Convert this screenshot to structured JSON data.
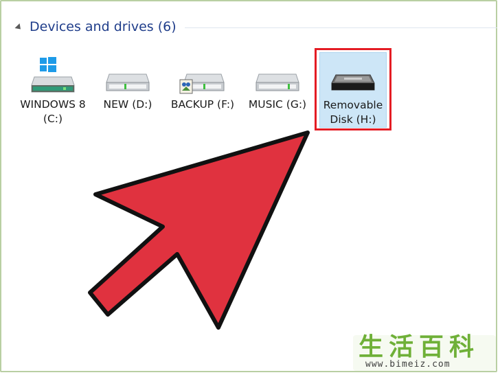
{
  "section": {
    "title": "Devices and drives (6)"
  },
  "drives": [
    {
      "label": "WINDOWS 8 (C:)",
      "icon": "windows-system-drive-icon"
    },
    {
      "label": "NEW (D:)",
      "icon": "hard-drive-icon"
    },
    {
      "label": "BACKUP (F:)",
      "icon": "backup-drive-icon"
    },
    {
      "label": "MUSIC (G:)",
      "icon": "hard-drive-icon"
    },
    {
      "label": "Removable Disk (H:)",
      "icon": "removable-disk-icon",
      "selected": true
    }
  ],
  "annotation": {
    "arrow_color": "#e0323f",
    "highlight_color": "#e41c24"
  },
  "watermark": {
    "title": "生活百科",
    "url": "www.bimeiz.com"
  }
}
